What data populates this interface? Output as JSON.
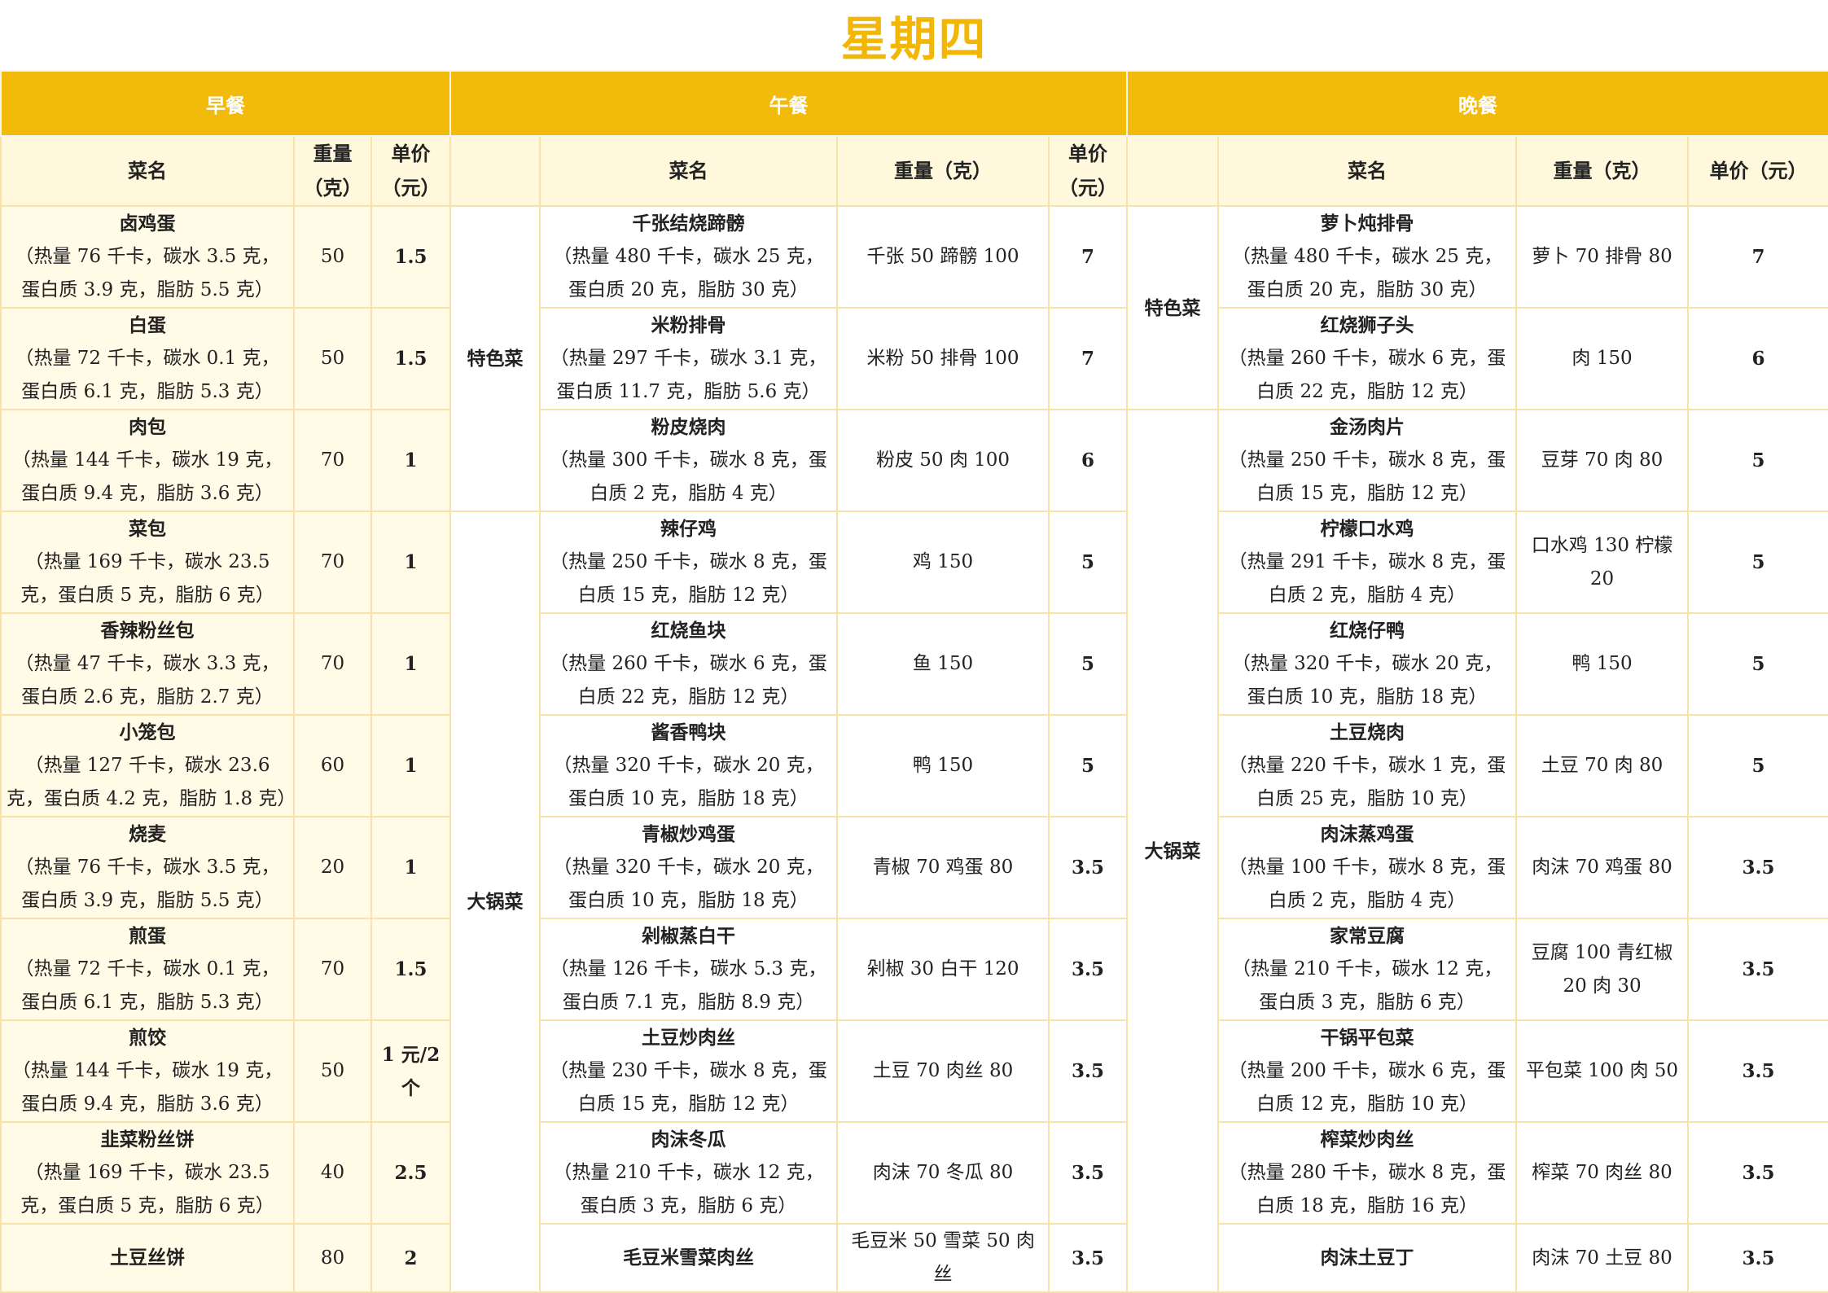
{
  "title": "星期四",
  "meals": {
    "breakfast": "早餐",
    "lunch": "午餐",
    "dinner": "晚餐"
  },
  "headers": {
    "b": [
      "菜名",
      "重量（克）",
      "单价（元）"
    ],
    "l": [
      "菜名",
      "重量（克）",
      "单价（元）"
    ],
    "d": [
      "菜名",
      "重量（克）",
      "单价（元）"
    ]
  },
  "categories": {
    "special": "特色菜",
    "bigpot": "大锅菜"
  },
  "breakfast": [
    {
      "name": "卤鸡蛋",
      "nutrition": "（热量 76 千卡，碳水 3.5 克，蛋白质 3.9 克，脂肪 5.5 克）",
      "weight": "50",
      "price": "1.5"
    },
    {
      "name": "白蛋",
      "nutrition": "（热量 72 千卡，碳水 0.1 克，蛋白质 6.1 克，脂肪 5.3 克）",
      "weight": "50",
      "price": "1.5"
    },
    {
      "name": "肉包",
      "nutrition": "（热量 144 千卡，碳水 19 克，蛋白质 9.4 克，脂肪 3.6 克）",
      "weight": "70",
      "price": "1"
    },
    {
      "name": "菜包",
      "nutrition": "（热量 169 千卡，碳水 23.5 克，蛋白质 5 克，脂肪 6 克）",
      "weight": "70",
      "price": "1"
    },
    {
      "name": "香辣粉丝包",
      "nutrition": "（热量 47 千卡，碳水 3.3 克，蛋白质 2.6 克，脂肪 2.7 克）",
      "weight": "70",
      "price": "1"
    },
    {
      "name": "小笼包",
      "nutrition": "（热量 127 千卡，碳水 23.6 克，蛋白质 4.2 克，脂肪 1.8 克）",
      "weight": "60",
      "price": "1"
    },
    {
      "name": "烧麦",
      "nutrition": "（热量 76 千卡，碳水 3.5 克，蛋白质 3.9 克，脂肪 5.5 克）",
      "weight": "20",
      "price": "1"
    },
    {
      "name": "煎蛋",
      "nutrition": "（热量 72 千卡，碳水 0.1 克，蛋白质 6.1 克，脂肪 5.3 克）",
      "weight": "70",
      "price": "1.5"
    },
    {
      "name": "煎饺",
      "nutrition": "（热量 144 千卡，碳水 19 克，蛋白质 9.4 克，脂肪 3.6 克）",
      "weight": "50",
      "price": "1 元/2 个"
    },
    {
      "name": "韭菜粉丝饼",
      "nutrition": "（热量 169 千卡，碳水 23.5 克，蛋白质 5 克，脂肪 6 克）",
      "weight": "40",
      "price": "2.5"
    },
    {
      "name": "土豆丝饼",
      "nutrition": "",
      "weight": "80",
      "price": "2"
    }
  ],
  "lunch": [
    {
      "name": "千张结烧蹄髈",
      "nutrition": "（热量 480 千卡，碳水 25 克，蛋白质 20 克，脂肪 30 克）",
      "weight": "千张 50 蹄髈 100",
      "price": "7"
    },
    {
      "name": "米粉排骨",
      "nutrition": "（热量 297 千卡，碳水 3.1 克，蛋白质 11.7 克，脂肪 5.6 克）",
      "weight": "米粉 50 排骨 100",
      "price": "7"
    },
    {
      "name": "粉皮烧肉",
      "nutrition": "（热量 300 千卡，碳水 8 克，蛋白质 2 克，脂肪 4 克）",
      "weight": "粉皮 50 肉 100",
      "price": "6"
    },
    {
      "name": "辣仔鸡",
      "nutrition": "（热量 250 千卡，碳水 8 克，蛋白质 15 克，脂肪 12 克）",
      "weight": "鸡 150",
      "price": "5"
    },
    {
      "name": "红烧鱼块",
      "nutrition": "（热量 260 千卡，碳水 6 克，蛋白质 22 克，脂肪 12 克）",
      "weight": "鱼 150",
      "price": "5"
    },
    {
      "name": "酱香鸭块",
      "nutrition": "（热量 320 千卡，碳水 20 克，蛋白质 10 克，脂肪 18 克）",
      "weight": "鸭 150",
      "price": "5"
    },
    {
      "name": "青椒炒鸡蛋",
      "nutrition": "（热量 320 千卡，碳水 20 克，蛋白质 10 克，脂肪 18 克）",
      "weight": "青椒 70 鸡蛋 80",
      "price": "3.5"
    },
    {
      "name": "剁椒蒸白干",
      "nutrition": "（热量 126 千卡，碳水 5.3 克，蛋白质 7.1 克，脂肪 8.9 克）",
      "weight": "剁椒 30 白干 120",
      "price": "3.5"
    },
    {
      "name": "土豆炒肉丝",
      "nutrition": "（热量 230 千卡，碳水 8 克，蛋白质 15 克，脂肪 12 克）",
      "weight": "土豆 70 肉丝 80",
      "price": "3.5"
    },
    {
      "name": "肉沫冬瓜",
      "nutrition": "（热量 210 千卡，碳水 12 克，蛋白质 3 克，脂肪 6 克）",
      "weight": "肉沫 70 冬瓜 80",
      "price": "3.5"
    },
    {
      "name": "毛豆米雪菜肉丝",
      "nutrition": "",
      "weight": "毛豆米 50 雪菜 50 肉丝",
      "price": "3.5"
    }
  ],
  "dinner": [
    {
      "name": "萝卜炖排骨",
      "nutrition": "（热量 480 千卡，碳水 25 克，蛋白质 20 克，脂肪 30 克）",
      "weight": "萝卜 70 排骨 80",
      "price": "7"
    },
    {
      "name": "红烧狮子头",
      "nutrition": "（热量 260 千卡，碳水 6 克，蛋白质 22 克，脂肪 12 克）",
      "weight": "肉 150",
      "price": "6"
    },
    {
      "name": "金汤肉片",
      "nutrition": "（热量 250 千卡，碳水 8 克，蛋白质 15 克，脂肪 12 克）",
      "weight": "豆芽 70 肉 80",
      "price": "5"
    },
    {
      "name": "柠檬口水鸡",
      "nutrition": "（热量 291 千卡，碳水 8 克，蛋白质 2 克，脂肪 4 克）",
      "weight": "口水鸡 130 柠檬 20",
      "price": "5"
    },
    {
      "name": "红烧仔鸭",
      "nutrition": "（热量 320 千卡，碳水 20 克，蛋白质 10 克，脂肪 18 克）",
      "weight": "鸭 150",
      "price": "5"
    },
    {
      "name": "土豆烧肉",
      "nutrition": "（热量 220 千卡，碳水 1 克，蛋白质 25 克，脂肪 10 克）",
      "weight": "土豆 70 肉 80",
      "price": "5"
    },
    {
      "name": "肉沫蒸鸡蛋",
      "nutrition": "（热量 100 千卡，碳水 8 克，蛋白质 2 克，脂肪 4 克）",
      "weight": "肉沫 70 鸡蛋 80",
      "price": "3.5"
    },
    {
      "name": "家常豆腐",
      "nutrition": "（热量 210 千卡，碳水 12 克，蛋白质 3 克，脂肪 6 克）",
      "weight": "豆腐 100 青红椒 20 肉 30",
      "price": "3.5"
    },
    {
      "name": "干锅平包菜",
      "nutrition": "（热量 200 千卡，碳水 6 克，蛋白质 12 克，脂肪 10 克）",
      "weight": "平包菜 100 肉 50",
      "price": "3.5"
    },
    {
      "name": "榨菜炒肉丝",
      "nutrition": "（热量 280 千卡，碳水 8 克，蛋白质 18 克，脂肪 16 克）",
      "weight": "榨菜 70 肉丝 80",
      "price": "3.5"
    },
    {
      "name": "肉沫土豆丁",
      "nutrition": "",
      "weight": "肉沫 70 土豆 80",
      "price": "3.5"
    }
  ]
}
